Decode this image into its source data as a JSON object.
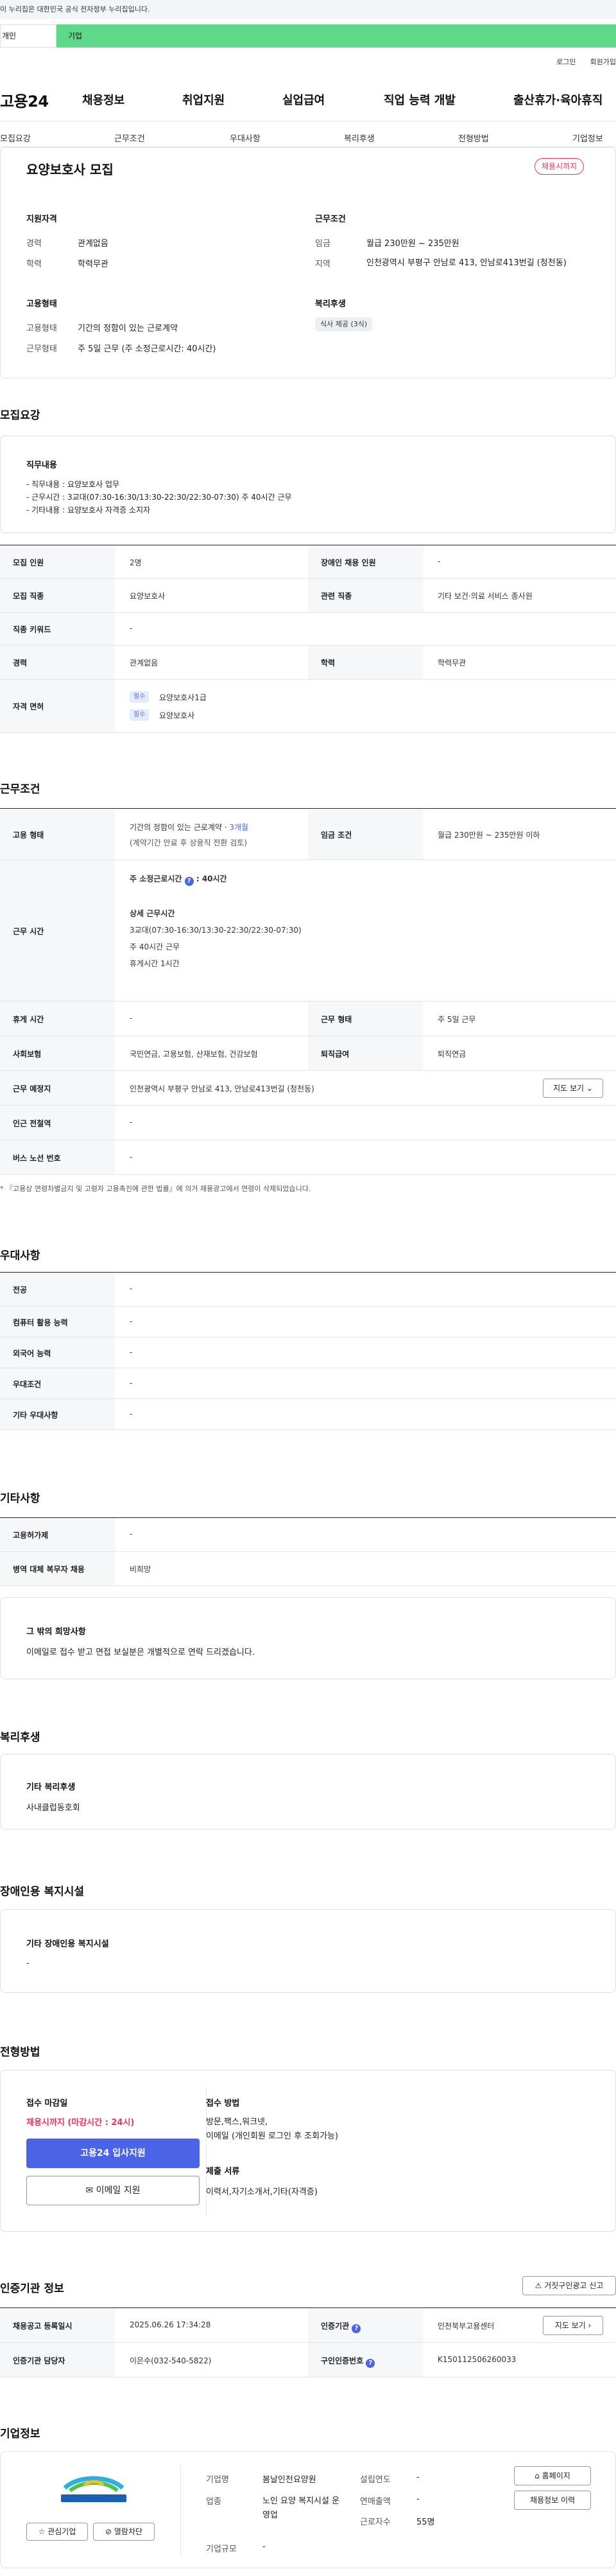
{
  "gov_banner": "이 누리집은 대한민국 공식 전자정부 누리집입니다.",
  "top_tabs": {
    "personal": "개인",
    "company": "기업"
  },
  "util_links": {
    "login": "로그인",
    "signup": "회원가입"
  },
  "header": {
    "logo": "고용24",
    "gnb": [
      "채용정보",
      "취업지원",
      "실업급여",
      "직업 능력 개발",
      "출산휴가·육아휴직"
    ]
  },
  "subnav": [
    "모집요강",
    "근무조건",
    "우대사항",
    "복리후생",
    "전형방법",
    "기업정보"
  ],
  "summary": {
    "title": "요양보호사 모집",
    "status_badge": "채용시까지",
    "qual_heading": "지원자격",
    "career_label": "경력",
    "career_value": "관계없음",
    "edu_label": "학력",
    "edu_value": "학력무관",
    "cond_heading": "근무조건",
    "wage_label": "임금",
    "wage_value": "월급 230만원 ~ 235만원",
    "region_label": "지역",
    "region_value": "인천광역시 부평구 안남로 413, 안남로413번길 (청천동)",
    "emp_heading": "고용형태",
    "emp_label": "고용형태",
    "emp_value": "기간의 정함이 있는 근로계약",
    "work_label": "근무형태",
    "work_value": "주 5일 근무 (주 소정근로시간: 40시간)",
    "welfare_heading": "복리후생",
    "welfare_chip": "식사 제공 (3식)"
  },
  "recruit": {
    "heading": "모집요강",
    "job_heading": "직무내용",
    "job_lines": [
      "- 직무내용 : 요양보호사 업무",
      "- 근무시간 : 3교대(07:30-16:30/13:30-22:30/22:30-07:30) 주 40시간 근무",
      "- 기타내용 : 요양보호사 자격증 소지자"
    ],
    "rows": {
      "count_label": "모집 인원",
      "count_value": "2명",
      "disabled_label": "장애인 채용 인원",
      "disabled_value": "-",
      "job_label": "모집 직종",
      "job_value": "요양보호사",
      "related_label": "관련 직종",
      "related_value": "기타 보건·의료 서비스 종사원",
      "keyword_label": "직종 키워드",
      "keyword_value": "-",
      "career_label": "경력",
      "career_value": "관계없음",
      "edu_label": "학력",
      "edu_value": "학력무관",
      "license_label": "자격 면허",
      "license_items": [
        {
          "tag": "필수",
          "name": "요양보호사1급"
        },
        {
          "tag": "필수",
          "name": "요양보호사"
        }
      ]
    }
  },
  "conditions": {
    "heading": "근무조건",
    "emp_label": "고용 형태",
    "emp_value_a": "기간의 정함이 있는 근로계약 · ",
    "emp_value_b": "3개월",
    "emp_value_c": "(계약기간 만료 후 상용직 전환 검토)",
    "wage_label": "임금 조건",
    "wage_value": "월급 230만원 ~ 235만원 이하",
    "hours_label": "근무 시간",
    "hours_head": "주 소정근로시간",
    "hours_head_val": ": 40시간",
    "hours_detail_head": "상세 근무시간",
    "hours_lines": [
      "3교대(07:30-16:30/13:30-22:30/22:30-07:30)",
      "주 40시간 근무",
      "휴게시간 1시간"
    ],
    "rest_label": "휴게 시간",
    "rest_value": "-",
    "form_label": "근무 형태",
    "form_value": "주 5일 근무",
    "insurance_label": "사회보험",
    "insurance_value": "국민연금, 고용보험, 산재보험, 건강보험",
    "retire_label": "퇴직급여",
    "retire_value": "퇴직연금",
    "place_label": "근무 예정지",
    "place_value": "인천광역시 부평구 안남로 413, 안남로413번길 (청천동)",
    "map_button": "지도 보기",
    "subway_label": "인근 전철역",
    "subway_value": "-",
    "bus_label": "버스 노선 번호",
    "bus_value": "-",
    "note": "* 『고용상 연령차별금지 및 고령자 고용촉진에 관한 법률』에 의거 채용광고에서 연령이 삭제되었습니다."
  },
  "preference": {
    "heading": "우대사항",
    "rows": [
      {
        "label": "전공",
        "value": "-"
      },
      {
        "label": "컴퓨터 활용 능력",
        "value": "-"
      },
      {
        "label": "외국어 능력",
        "value": "-"
      },
      {
        "label": "우대조건",
        "value": "-"
      },
      {
        "label": "기타 우대사항",
        "value": "-"
      }
    ]
  },
  "etc": {
    "heading": "기타사항",
    "rows": [
      {
        "label": "고용허가제",
        "value": "-"
      },
      {
        "label": "병역 대체 복무자 채용",
        "value": "비희망"
      }
    ],
    "wish_heading": "그 밖의 희망사항",
    "wish_text": "이메일로 접수 받고 면접 보실분은 개별적으로 연락 드리겠습니다."
  },
  "welfare": {
    "heading": "복리후생",
    "sub": "기타 복리후생",
    "value": "사내클럽동호회"
  },
  "disability": {
    "heading": "장애인용 복지시설",
    "sub": "기타 장애인용 복지시설",
    "value": "-"
  },
  "selection": {
    "heading": "전형방법",
    "deadline_label": "접수 마감일",
    "deadline_value": "채용시까지 (마감시간 : 24시)",
    "apply_button": "고용24 입사지원",
    "email_button": "이메일 지원",
    "method_label": "접수 방법",
    "method_value": "방문,팩스,워크넷,\n이메일 (개인회원 로그인 후 조회가능)",
    "docs_label": "제출 서류",
    "docs_value": "이력서,자기소개서,기타(자격증)"
  },
  "cert": {
    "heading": "인증기관 정보",
    "report_button": "거짓구인광고 신고",
    "reg_label": "채용공고 등록일시",
    "reg_value": "2025.06.26 17:34:28",
    "org_label": "인증기관",
    "org_value": "인천북부고용센터",
    "org_map_button": "지도 보기",
    "mgr_label": "인증기관 담당자",
    "mgr_value": "이은수(032-540-5822)",
    "no_label": "구인인증번호",
    "no_value": "K150112506260033"
  },
  "company": {
    "heading": "기업정보",
    "interest_button": "관심기업",
    "block_button": "열람차단",
    "name_label": "기업명",
    "name_value": "봄날인천요양원",
    "year_label": "설립연도",
    "year_value": "-",
    "biz_label": "업종",
    "biz_value": "노인 요양 복지시설 운영업",
    "sales_label": "연매출액",
    "sales_value": "-",
    "emp_label": "근로자수",
    "emp_value": "55명",
    "scale_label": "기업규모",
    "scale_value": "-",
    "home_button": "홈페이지",
    "more_button": "채용정보 이력",
    "logo_text": "봄날인천요양원"
  },
  "colors": {
    "accent_green": "#5fd889",
    "primary_blue": "#4a63e7",
    "danger": "#e8355a"
  }
}
